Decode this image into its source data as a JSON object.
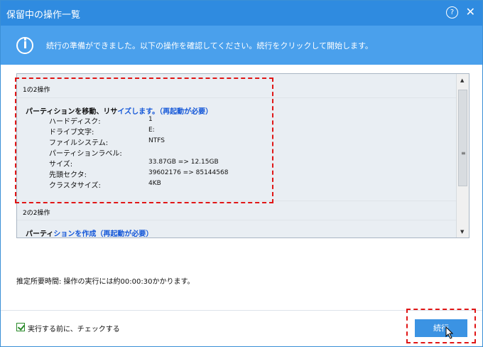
{
  "window": {
    "title": "保留中の操作一覧",
    "help_icon": "?",
    "close_icon": "✕"
  },
  "banner": {
    "icon": "info-icon",
    "text": "続行の準備ができました。以下の操作を確認してください。続行をクリックして開始します。"
  },
  "operations": [
    {
      "header": "1の2操作",
      "title_black": "パーティションを移動、リサ",
      "title_blue": "イズします。（再起動が必要）",
      "details": [
        {
          "label": "ハードディスク:",
          "value": "1"
        },
        {
          "label": "ドライブ文字:",
          "value": "E:"
        },
        {
          "label": "ファイルシステム:",
          "value": "NTFS"
        },
        {
          "label": "パーティションラベル:",
          "value": ""
        },
        {
          "label": "サイズ:",
          "value": "33.87GB => 12.15GB"
        },
        {
          "label": "先頭セクタ:",
          "value": "39602176 => 85144568"
        },
        {
          "label": "クラスタサイズ:",
          "value": "4KB"
        }
      ]
    },
    {
      "header": "2の2操作",
      "title_black": "パーティ",
      "title_blue": "ションを作成（再起動が必要）"
    }
  ],
  "estimate_text": "推定所要時間: 操作の実行には約00:00:30かかります。",
  "footer": {
    "checkbox_label": "実行する前に、チェックする",
    "checkbox_checked": true,
    "continue_label": "続行"
  },
  "colors": {
    "titlebar": "#2f8be0",
    "banner": "#4aa0ec",
    "highlight": "#e01616",
    "link_blue": "#1457d8"
  }
}
